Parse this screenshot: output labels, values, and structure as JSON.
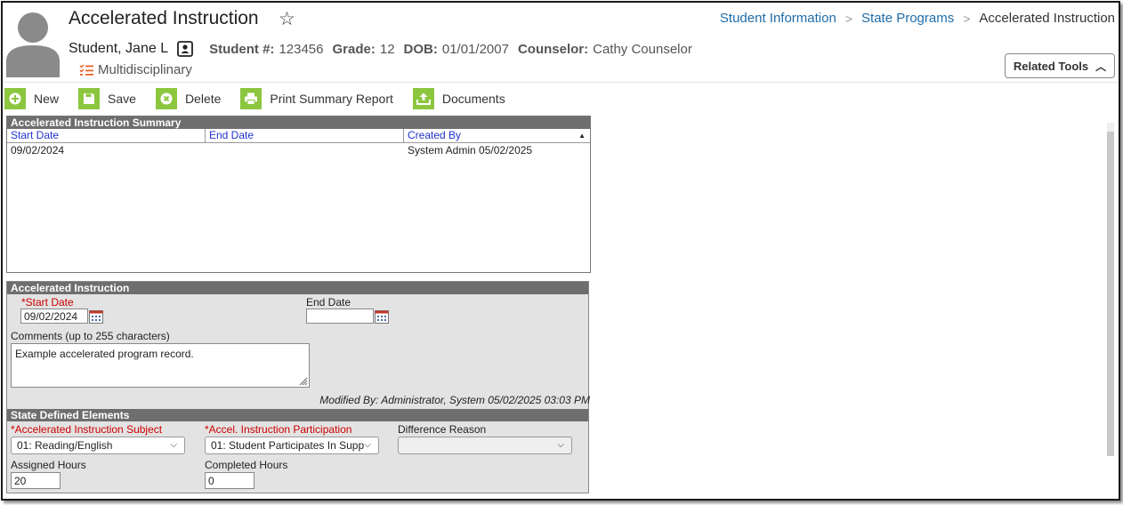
{
  "header": {
    "title": "Accelerated Instruction",
    "breadcrumbs": [
      "Student Information",
      "State Programs",
      "Accelerated Instruction"
    ],
    "student_name": "Student, Jane L",
    "student_num_label": "Student #:",
    "student_num": "123456",
    "grade_label": "Grade:",
    "grade": "12",
    "dob_label": "DOB:",
    "dob": "01/01/2007",
    "counselor_label": "Counselor:",
    "counselor": "Cathy Counselor",
    "multidisciplinary": "Multidisciplinary",
    "related_tools": "Related Tools"
  },
  "toolbar": {
    "new": "New",
    "save": "Save",
    "delete": "Delete",
    "print": "Print Summary Report",
    "documents": "Documents"
  },
  "summary": {
    "title": "Accelerated Instruction Summary",
    "columns": [
      "Start Date",
      "End Date",
      "Created By"
    ],
    "rows": [
      [
        "09/02/2024",
        "",
        "System Admin 05/02/2025"
      ]
    ]
  },
  "detail": {
    "title": "Accelerated Instruction",
    "start_date_label": "*Start Date",
    "start_date": "09/02/2024",
    "end_date_label": "End Date",
    "end_date": "",
    "comments_label": "Comments (up to 255 characters)",
    "comments": "Example accelerated program record.",
    "modified": "Modified By: Administrator, System 05/02/2025 03:03 PM"
  },
  "state": {
    "title": "State Defined Elements",
    "subject_label": "*Accelerated Instruction Subject",
    "subject": "01: Reading/English",
    "participation_label": "*Accel. Instruction Participation",
    "participation": "01: Student Participates In Supp",
    "diff_label": "Difference Reason",
    "diff": "",
    "assigned_label": "Assigned Hours",
    "assigned": "20",
    "completed_label": "Completed Hours",
    "completed": "0"
  },
  "colors": {
    "accent_green": "#8cc63f",
    "link_blue": "#1f6ca8",
    "header_gray": "#6e6e6e",
    "required_red": "#cc0000",
    "orange_icon": "#e8632b"
  }
}
